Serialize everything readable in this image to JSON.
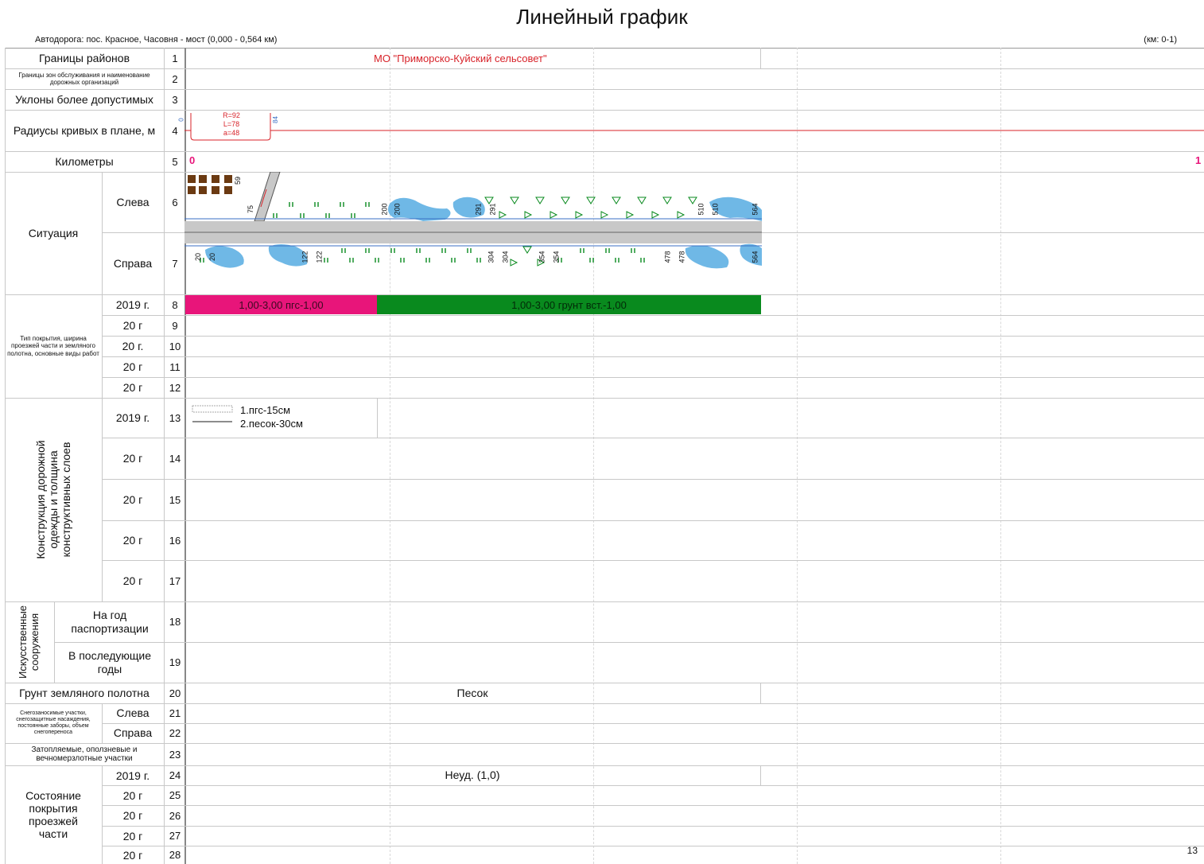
{
  "header": {
    "title": "Линейный график",
    "subtitle": "Автодорога: пос. Красное, Часовня - мост (0,000 - 0,564 км)",
    "km_range": "(км: 0-1)",
    "page_number": "13"
  },
  "rows": {
    "r1": {
      "label": "Границы районов",
      "num": "1",
      "value": "МО \"Приморско-Куйский сельсовет\""
    },
    "r2": {
      "label": "Границы зон обслуживания и наименование дорожных организаций",
      "num": "2"
    },
    "r3": {
      "label": "Уклоны более допустимых",
      "num": "3"
    },
    "r4": {
      "label": "Радиусы кривых в плане, м",
      "num": "4",
      "curve": [
        "R=92",
        "L=78",
        "a=48"
      ],
      "start": "0",
      "end": "84"
    },
    "r5": {
      "label": "Километры",
      "num": "5",
      "km_start": "0",
      "km_end": "1"
    },
    "situation": {
      "label": "Ситуация",
      "left": "Слева",
      "right": "Справа",
      "num_left": "6",
      "num_right": "7",
      "left_marks": [
        "59",
        "75",
        "200",
        "200",
        "291",
        "291",
        "510",
        "510",
        "564"
      ],
      "right_marks": [
        "20",
        "20",
        "122",
        "122",
        "304",
        "304",
        "354",
        "354",
        "478",
        "478",
        "564"
      ]
    },
    "coating": {
      "label": "Тип покрытия, ширина проезжей части и земляного полотна, основные виды работ",
      "years": [
        "2019 г.",
        "20   г",
        "20   г.",
        "20   г",
        "20   г"
      ],
      "nums": [
        "8",
        "9",
        "10",
        "11",
        "12"
      ],
      "segment1": "1,00-3,00 пгс-1,00",
      "segment2": "1,00-3,00 грунт вст.-1,00"
    },
    "construction": {
      "label": "Конструкция дорожной одежды и толщина конструктивных слоев",
      "years": [
        "2019 г.",
        "20   г",
        "20   г",
        "20   г",
        "20   г"
      ],
      "nums": [
        "13",
        "14",
        "15",
        "16",
        "17"
      ],
      "layer1": "1.пгс-15см",
      "layer2": "2.песок-30см"
    },
    "structures": {
      "label": "Искусственные сооружения",
      "a": "На год паспортизации",
      "b": "В последующие годы",
      "num_a": "18",
      "num_b": "19"
    },
    "r20": {
      "label": "Грунт земляного полотна",
      "num": "20",
      "value": "Песок"
    },
    "snow": {
      "label": "Снегозаносимые участки, снегозащитные насаждения, постоянные заборы, объем снегопереноса",
      "left": "Слева",
      "right": "Справа",
      "num_left": "21",
      "num_right": "22"
    },
    "r23": {
      "label": "Затопляемые, оползневые и вечномерзлотные участки",
      "num": "23"
    },
    "condition": {
      "label": "Состояние покрытия проезжей части",
      "years": [
        "2019 г.",
        "20   г",
        "20   г",
        "20   г",
        "20   г"
      ],
      "nums": [
        "24",
        "25",
        "26",
        "27",
        "28"
      ],
      "value": "Неуд. (1,0)"
    }
  },
  "colors": {
    "pink": "#e8157a",
    "green": "#098a1e",
    "red": "#d8232a",
    "water": "#6fb8e6",
    "road": "#c8c8c8",
    "brown": "#6b3a12"
  }
}
